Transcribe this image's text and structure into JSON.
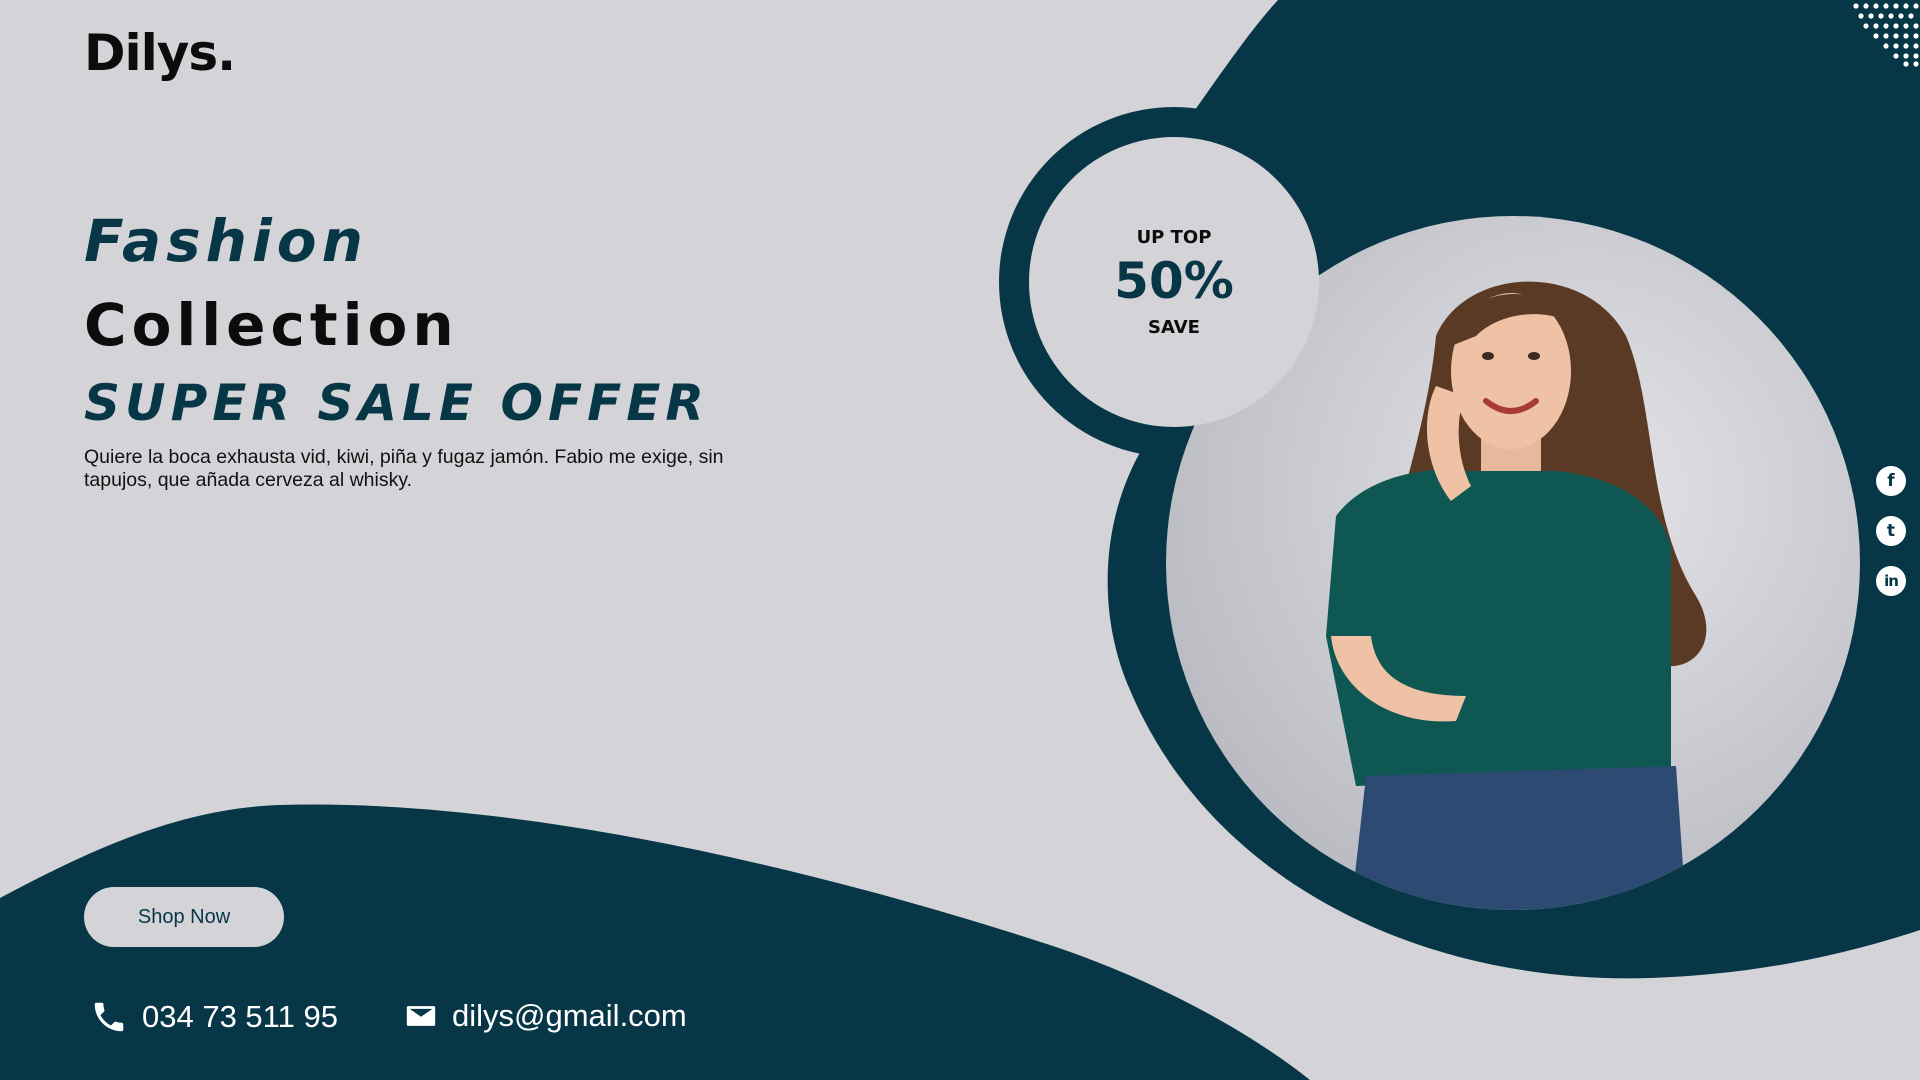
{
  "brand": {
    "logo": "Dilys."
  },
  "hero": {
    "line1": "Fashion",
    "line2": "Collection",
    "line3": "SUPER SALE OFFER",
    "description": "Quiere la boca exhausta vid, kiwi, piña y fugaz jamón. Fabio me exige, sin tapujos, que añada cerveza al whisky."
  },
  "cta": {
    "label": "Shop Now"
  },
  "contact": {
    "phone": "034 73 511 95",
    "email": "dilys@gmail.com",
    "phone_icon": "phone-icon",
    "email_icon": "mail-icon"
  },
  "badge": {
    "top": "UP TOP",
    "value": "50%",
    "bottom": "SAVE"
  },
  "socials": {
    "items": [
      {
        "icon": "facebook-icon",
        "glyph": "f"
      },
      {
        "icon": "twitter-icon",
        "glyph": "t"
      },
      {
        "icon": "linkedin-icon",
        "glyph": "in"
      }
    ]
  },
  "photo": {
    "subject": "woman-portrait"
  },
  "colors": {
    "background": "#d4d3d8",
    "primary": "#073746",
    "text_dark": "#0c0c0c",
    "white": "#ffffff"
  }
}
